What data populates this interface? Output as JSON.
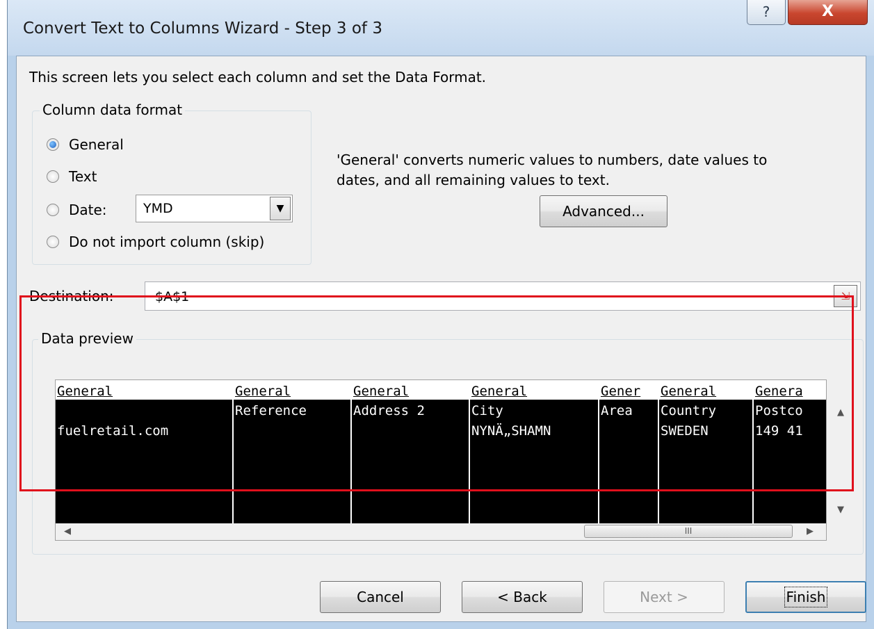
{
  "window": {
    "title": "Convert Text to Columns Wizard - Step 3 of 3",
    "help_label": "?",
    "close_label": "X"
  },
  "intro_text": "This screen lets you select each column and set the Data Format.",
  "column_format": {
    "title": "Column data format",
    "options": [
      {
        "label": "General",
        "checked": true
      },
      {
        "label": "Text",
        "checked": false
      },
      {
        "label": "Date:",
        "checked": false
      },
      {
        "label": "Do not import column (skip)",
        "checked": false
      }
    ],
    "date_value": "YMD"
  },
  "description": {
    "line1": "'General' converts numeric values to numbers, date values to",
    "line2": "dates, and all remaining values to text."
  },
  "advanced_label": "Advanced...",
  "destination": {
    "label": "Destination:",
    "value": "$A$1"
  },
  "preview": {
    "title": "Data preview",
    "columns": [
      {
        "header": "General",
        "cells": [
          "",
          "fuelretail.com"
        ]
      },
      {
        "header": "General",
        "cells": [
          "Reference",
          ""
        ]
      },
      {
        "header": "General",
        "cells": [
          "Address 2",
          ""
        ]
      },
      {
        "header": "General",
        "cells": [
          "City",
          "NYNÄ„SHAMN"
        ]
      },
      {
        "header": "Gener",
        "cells": [
          "Area",
          ""
        ]
      },
      {
        "header": "General",
        "cells": [
          "Country",
          "SWEDEN"
        ]
      },
      {
        "header": "Genera",
        "cells": [
          "Postco",
          "149 41"
        ]
      }
    ],
    "scroll_thumb_label": "III"
  },
  "buttons": {
    "cancel": "Cancel",
    "back": "< Back",
    "next": "Next >",
    "finish": "Finish"
  }
}
